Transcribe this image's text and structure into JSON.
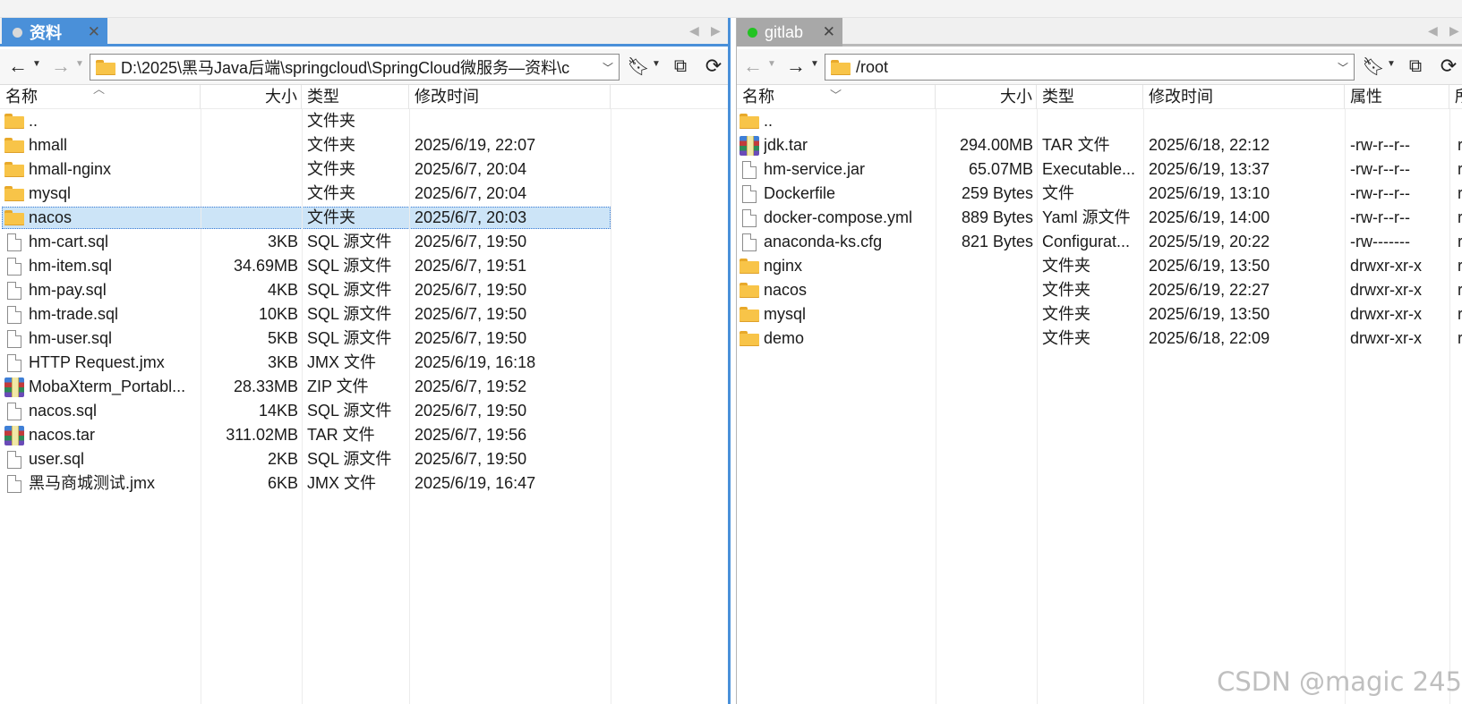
{
  "left_pane": {
    "tab": {
      "label": "资料",
      "dot_color": "#d9d9d9"
    },
    "path": "D:\\2025\\黑马Java后端\\springcloud\\SpringCloud微服务—资料\\c",
    "columns": {
      "name": "名称",
      "size": "大小",
      "type": "类型",
      "modified": "修改时间"
    },
    "rows": [
      {
        "icon": "folder-icon",
        "name": "..",
        "size": "",
        "type": "文件夹",
        "modified": ""
      },
      {
        "icon": "folder-icon",
        "name": "hmall",
        "size": "",
        "type": "文件夹",
        "modified": "2025/6/19, 22:07"
      },
      {
        "icon": "folder-icon",
        "name": "hmall-nginx",
        "size": "",
        "type": "文件夹",
        "modified": "2025/6/7, 20:04"
      },
      {
        "icon": "folder-icon",
        "name": "mysql",
        "size": "",
        "type": "文件夹",
        "modified": "2025/6/7, 20:04"
      },
      {
        "icon": "folder-icon",
        "name": "nacos",
        "size": "",
        "type": "文件夹",
        "modified": "2025/6/7, 20:03",
        "selected": true
      },
      {
        "icon": "file-icon",
        "name": "hm-cart.sql",
        "size": "3KB",
        "type": "SQL 源文件",
        "modified": "2025/6/7, 19:50"
      },
      {
        "icon": "file-icon",
        "name": "hm-item.sql",
        "size": "34.69MB",
        "type": "SQL 源文件",
        "modified": "2025/6/7, 19:51"
      },
      {
        "icon": "file-icon",
        "name": "hm-pay.sql",
        "size": "4KB",
        "type": "SQL 源文件",
        "modified": "2025/6/7, 19:50"
      },
      {
        "icon": "file-icon",
        "name": "hm-trade.sql",
        "size": "10KB",
        "type": "SQL 源文件",
        "modified": "2025/6/7, 19:50"
      },
      {
        "icon": "file-icon",
        "name": "hm-user.sql",
        "size": "5KB",
        "type": "SQL 源文件",
        "modified": "2025/6/7, 19:50"
      },
      {
        "icon": "file-icon",
        "name": "HTTP Request.jmx",
        "size": "3KB",
        "type": "JMX 文件",
        "modified": "2025/6/19, 16:18"
      },
      {
        "icon": "archive-icon",
        "name": "MobaXterm_Portabl...",
        "size": "28.33MB",
        "type": "ZIP 文件",
        "modified": "2025/6/7, 19:52"
      },
      {
        "icon": "file-icon",
        "name": "nacos.sql",
        "size": "14KB",
        "type": "SQL 源文件",
        "modified": "2025/6/7, 19:50"
      },
      {
        "icon": "archive-icon",
        "name": "nacos.tar",
        "size": "311.02MB",
        "type": "TAR 文件",
        "modified": "2025/6/7, 19:56"
      },
      {
        "icon": "file-icon",
        "name": "user.sql",
        "size": "2KB",
        "type": "SQL 源文件",
        "modified": "2025/6/7, 19:50"
      },
      {
        "icon": "file-icon",
        "name": "黑马商城测试.jmx",
        "size": "6KB",
        "type": "JMX 文件",
        "modified": "2025/6/19, 16:47"
      }
    ]
  },
  "right_pane": {
    "tab": {
      "label": "gitlab",
      "dot_color": "#22c322"
    },
    "path": "/root",
    "columns": {
      "name": "名称",
      "size": "大小",
      "type": "类型",
      "modified": "修改时间",
      "attrs": "属性",
      "owner": "所"
    },
    "rows": [
      {
        "icon": "folder-icon",
        "name": "..",
        "size": "",
        "type": "",
        "modified": "",
        "attrs": ""
      },
      {
        "icon": "archive-icon",
        "name": "jdk.tar",
        "size": "294.00MB",
        "type": "TAR 文件",
        "modified": "2025/6/18, 22:12",
        "attrs": "-rw-r--r--",
        "owner": "r"
      },
      {
        "icon": "file-icon",
        "name": "hm-service.jar",
        "size": "65.07MB",
        "type": "Executable...",
        "modified": "2025/6/19, 13:37",
        "attrs": "-rw-r--r--",
        "owner": "r"
      },
      {
        "icon": "file-icon",
        "name": "Dockerfile",
        "size": "259 Bytes",
        "type": "文件",
        "modified": "2025/6/19, 13:10",
        "attrs": "-rw-r--r--",
        "owner": "r"
      },
      {
        "icon": "file-icon",
        "name": "docker-compose.yml",
        "size": "889 Bytes",
        "type": "Yaml 源文件",
        "modified": "2025/6/19, 14:00",
        "attrs": "-rw-r--r--",
        "owner": "r"
      },
      {
        "icon": "file-icon",
        "name": "anaconda-ks.cfg",
        "size": "821 Bytes",
        "type": "Configurat...",
        "modified": "2025/5/19, 20:22",
        "attrs": "-rw-------",
        "owner": "r"
      },
      {
        "icon": "folder-icon",
        "name": "nginx",
        "size": "",
        "type": "文件夹",
        "modified": "2025/6/19, 13:50",
        "attrs": "drwxr-xr-x",
        "owner": "r"
      },
      {
        "icon": "folder-icon",
        "name": "nacos",
        "size": "",
        "type": "文件夹",
        "modified": "2025/6/19, 22:27",
        "attrs": "drwxr-xr-x",
        "owner": "r"
      },
      {
        "icon": "folder-icon",
        "name": "mysql",
        "size": "",
        "type": "文件夹",
        "modified": "2025/6/19, 13:50",
        "attrs": "drwxr-xr-x",
        "owner": "r"
      },
      {
        "icon": "folder-icon",
        "name": "demo",
        "size": "",
        "type": "文件夹",
        "modified": "2025/6/18, 22:09",
        "attrs": "drwxr-xr-x",
        "owner": "r"
      }
    ]
  },
  "watermark": "CSDN @magic 245"
}
